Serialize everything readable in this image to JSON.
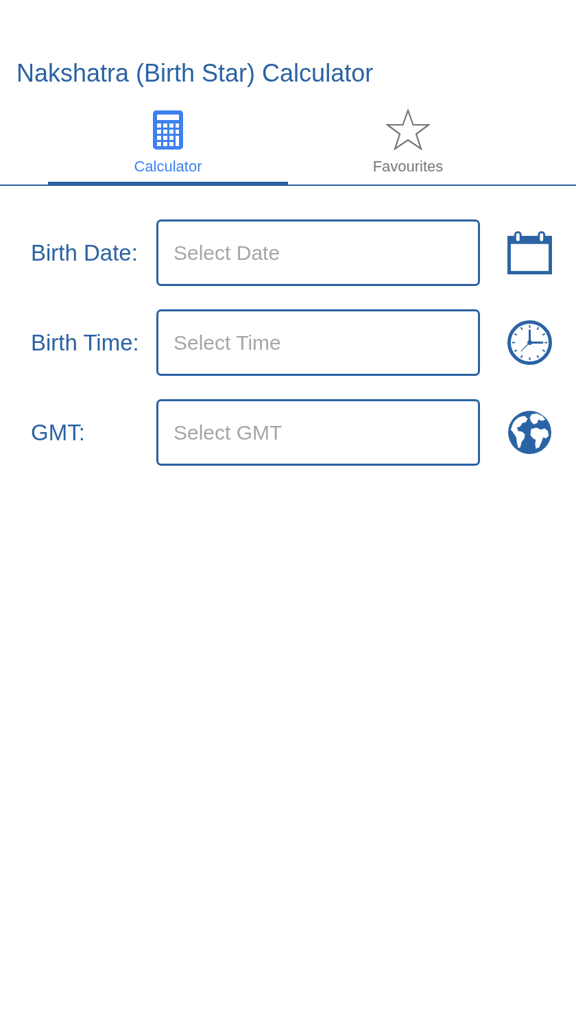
{
  "title": "Nakshatra (Birth Star) Calculator",
  "tabs": [
    {
      "kind": "calculator",
      "label": "Calculator",
      "selected": true
    },
    {
      "kind": "star",
      "label": "Favourites",
      "selected": false
    }
  ],
  "fields": [
    {
      "kind": "date",
      "label": "Birth Date:",
      "placeholder": "Select Date"
    },
    {
      "kind": "time",
      "label": "Birth Time:",
      "placeholder": "Select Time"
    },
    {
      "kind": "gmt",
      "label": "GMT:",
      "placeholder": "Select GMT"
    }
  ]
}
